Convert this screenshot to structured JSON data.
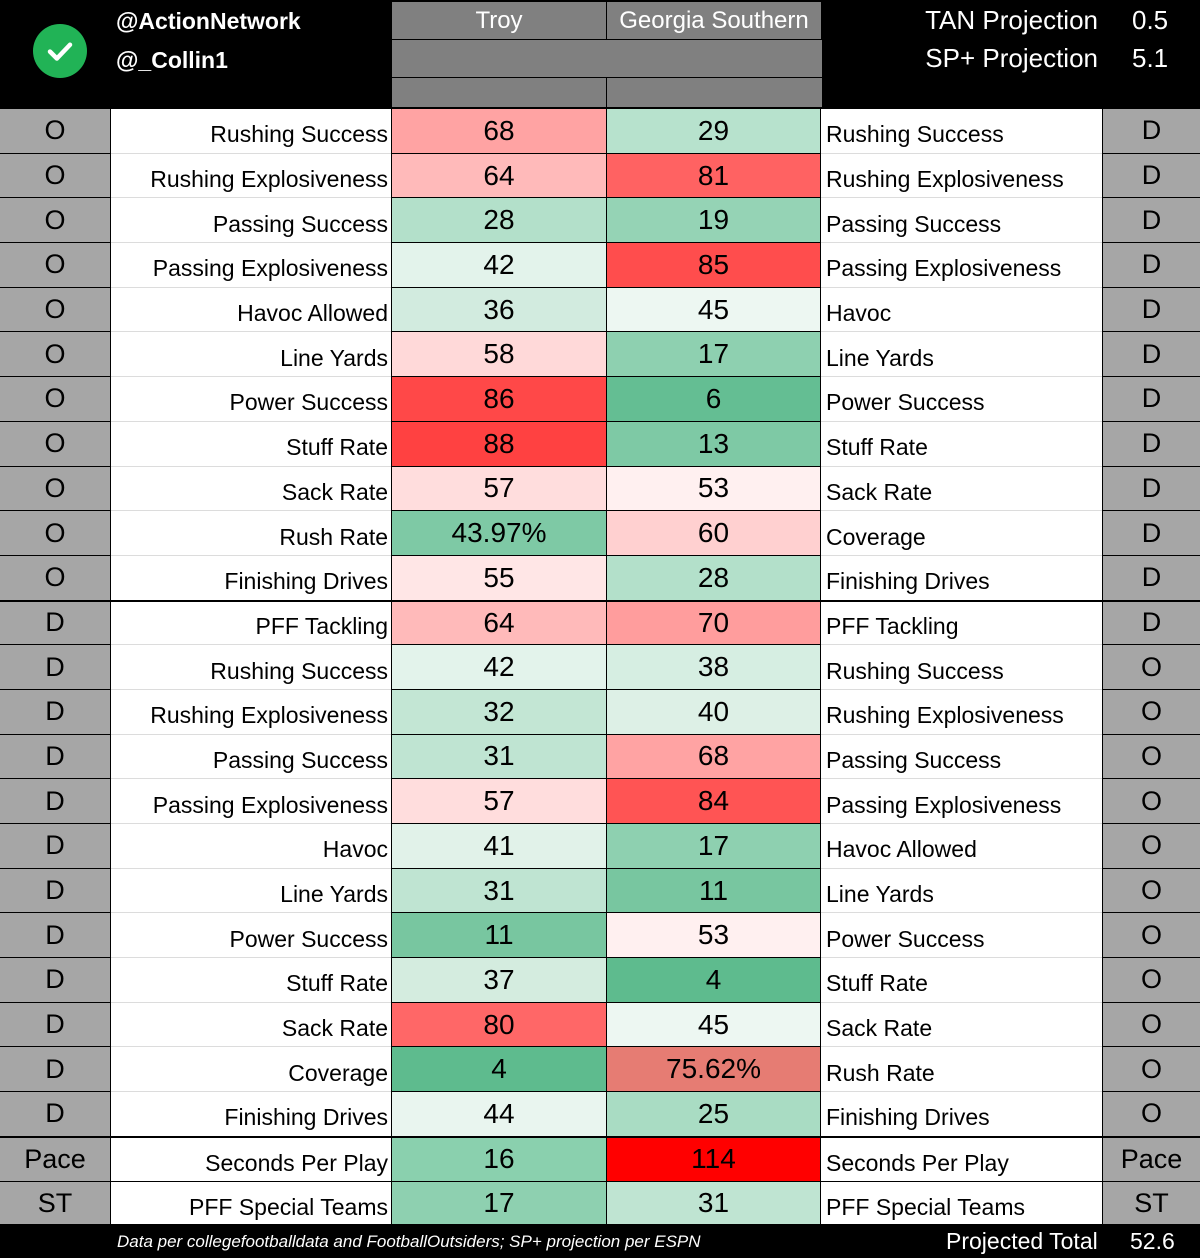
{
  "header": {
    "logo_icon": "check-circle-icon",
    "handles": [
      "@ActionNetwork",
      "@_Collin1"
    ],
    "teams": [
      "Troy",
      "Georgia Southern"
    ],
    "projections": [
      {
        "label": "TAN Projection",
        "value": "0.5"
      },
      {
        "label": "SP+ Projection",
        "value": "5.1"
      }
    ]
  },
  "rows": [
    {
      "left_side": "O",
      "left_label": "Rushing Success",
      "troy": "68",
      "troy_color": "#ffa3a3",
      "gs": "29",
      "gs_color": "#b7e2cd",
      "right_label": "Rushing Success",
      "right_side": "D"
    },
    {
      "left_side": "O",
      "left_label": "Rushing Explosiveness",
      "troy": "64",
      "troy_color": "#ffbaba",
      "gs": "81",
      "gs_color": "#ff6262",
      "right_label": "Rushing Explosiveness",
      "right_side": "D"
    },
    {
      "left_side": "O",
      "left_label": "Passing Success",
      "troy": "28",
      "troy_color": "#b3e0ca",
      "gs": "19",
      "gs_color": "#95d3b5",
      "right_label": "Passing Success",
      "right_side": "D"
    },
    {
      "left_side": "O",
      "left_label": "Passing Explosiveness",
      "troy": "42",
      "troy_color": "#e3f3eb",
      "gs": "85",
      "gs_color": "#ff4d4d",
      "right_label": "Passing Explosiveness",
      "right_side": "D"
    },
    {
      "left_side": "O",
      "left_label": "Havoc Allowed",
      "troy": "36",
      "troy_color": "#d2ebdf",
      "gs": "45",
      "gs_color": "#edf7f2",
      "right_label": "Havoc",
      "right_side": "D"
    },
    {
      "left_side": "O",
      "left_label": "Line Yards",
      "troy": "58",
      "troy_color": "#ffd9d9",
      "gs": "17",
      "gs_color": "#8ed0b0",
      "right_label": "Line Yards",
      "right_side": "D"
    },
    {
      "left_side": "O",
      "left_label": "Power Success",
      "troy": "86",
      "troy_color": "#ff4848",
      "gs": "6",
      "gs_color": "#64be93",
      "right_label": "Power Success",
      "right_side": "D"
    },
    {
      "left_side": "O",
      "left_label": "Stuff Rate",
      "troy": "88",
      "troy_color": "#ff4141",
      "gs": "13",
      "gs_color": "#7ec9a5",
      "right_label": "Stuff Rate",
      "right_side": "D"
    },
    {
      "left_side": "O",
      "left_label": "Sack Rate",
      "troy": "57",
      "troy_color": "#ffdddd",
      "gs": "53",
      "gs_color": "#fff0f0",
      "right_label": "Sack Rate",
      "right_side": "D"
    },
    {
      "left_side": "O",
      "left_label": "Rush Rate",
      "troy": "43.97%",
      "troy_color": "#7ec9a5",
      "gs": "60",
      "gs_color": "#ffd0d0",
      "right_label": "Coverage",
      "right_side": "D"
    },
    {
      "left_side": "O",
      "left_label": "Finishing Drives",
      "troy": "55",
      "troy_color": "#ffe6e6",
      "gs": "28",
      "gs_color": "#b3e0ca",
      "right_label": "Finishing Drives",
      "right_side": "D"
    },
    {
      "left_side": "D",
      "left_label": "PFF Tackling",
      "troy": "64",
      "troy_color": "#ffbaba",
      "gs": "70",
      "gs_color": "#ff9d9d",
      "right_label": "PFF Tackling",
      "right_side": "D"
    },
    {
      "left_side": "D",
      "left_label": "Rushing Success",
      "troy": "42",
      "troy_color": "#e3f3eb",
      "gs": "38",
      "gs_color": "#d6eee2",
      "right_label": "Rushing Success",
      "right_side": "O"
    },
    {
      "left_side": "D",
      "left_label": "Rushing Explosiveness",
      "troy": "32",
      "troy_color": "#c3e6d4",
      "gs": "40",
      "gs_color": "#ddf0e6",
      "right_label": "Rushing Explosiveness",
      "right_side": "O"
    },
    {
      "left_side": "D",
      "left_label": "Passing Success",
      "troy": "31",
      "troy_color": "#bfe4d2",
      "gs": "68",
      "gs_color": "#ffa3a3",
      "right_label": "Passing Success",
      "right_side": "O"
    },
    {
      "left_side": "D",
      "left_label": "Passing Explosiveness",
      "troy": "57",
      "troy_color": "#ffdddd",
      "gs": "84",
      "gs_color": "#ff5454",
      "right_label": "Passing Explosiveness",
      "right_side": "O"
    },
    {
      "left_side": "D",
      "left_label": "Havoc",
      "troy": "41",
      "troy_color": "#e1f2e9",
      "gs": "17",
      "gs_color": "#8ed0b0",
      "right_label": "Havoc Allowed",
      "right_side": "O"
    },
    {
      "left_side": "D",
      "left_label": "Line Yards",
      "troy": "31",
      "troy_color": "#bfe4d2",
      "gs": "11",
      "gs_color": "#78c6a0",
      "right_label": "Line Yards",
      "right_side": "O"
    },
    {
      "left_side": "D",
      "left_label": "Power Success",
      "troy": "11",
      "troy_color": "#78c6a0",
      "gs": "53",
      "gs_color": "#fff0f0",
      "right_label": "Power Success",
      "right_side": "O"
    },
    {
      "left_side": "D",
      "left_label": "Stuff Rate",
      "troy": "37",
      "troy_color": "#d4ecdf",
      "gs": "4",
      "gs_color": "#5ebb8e",
      "right_label": "Stuff Rate",
      "right_side": "O"
    },
    {
      "left_side": "D",
      "left_label": "Sack Rate",
      "troy": "80",
      "troy_color": "#ff6767",
      "gs": "45",
      "gs_color": "#edf7f2",
      "right_label": "Sack Rate",
      "right_side": "O"
    },
    {
      "left_side": "D",
      "left_label": "Coverage",
      "troy": "4",
      "troy_color": "#5ebb8e",
      "gs": "75.62%",
      "gs_color": "#e67c73",
      "right_label": "Rush Rate",
      "right_side": "O"
    },
    {
      "left_side": "D",
      "left_label": "Finishing Drives",
      "troy": "44",
      "troy_color": "#e9f5ef",
      "gs": "25",
      "gs_color": "#a9dcc3",
      "right_label": "Finishing Drives",
      "right_side": "O"
    },
    {
      "left_side": "Pace",
      "left_label": "Seconds Per Play",
      "troy": "16",
      "troy_color": "#8ad0ae",
      "gs": "114",
      "gs_color": "#ff0000",
      "right_label": "Seconds Per Play",
      "right_side": "Pace"
    },
    {
      "left_side": "ST",
      "left_label": "PFF Special Teams",
      "troy": "17",
      "troy_color": "#8ed0b0",
      "gs": "31",
      "gs_color": "#bfe4d2",
      "right_label": "PFF Special Teams",
      "right_side": "ST"
    }
  ],
  "footer": {
    "credit": "Data per collegefootballdata and FootballOutsiders; SP+ projection per ESPN",
    "total_label": "Projected Total",
    "total_value": "52.6"
  }
}
